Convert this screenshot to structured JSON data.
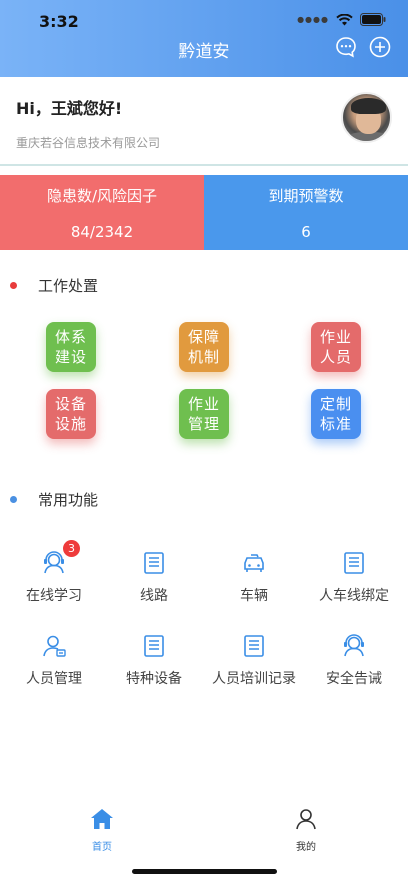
{
  "status_bar": {
    "time": "3:32"
  },
  "nav": {
    "title": "黔道安"
  },
  "profile": {
    "greeting": "Hi，王斌您好!",
    "company": "重庆若谷信息技术有限公司"
  },
  "stats": [
    {
      "label": "隐患数/风险因子",
      "value": "84/2342",
      "color": "#f26d6d"
    },
    {
      "label": "到期预警数",
      "value": "6",
      "color": "#4a98ec"
    }
  ],
  "work_section": {
    "title": "工作处置",
    "dot_color": "#e83c3c",
    "tiles": [
      {
        "line1": "体系",
        "line2": "建设",
        "color": "#6fbf4f"
      },
      {
        "line1": "保障",
        "line2": "机制",
        "color": "#e19a3e"
      },
      {
        "line1": "作业",
        "line2": "人员",
        "color": "#e46b6b"
      },
      {
        "line1": "设备",
        "line2": "设施",
        "color": "#e46b6b"
      },
      {
        "line1": "作业",
        "line2": "管理",
        "color": "#6fbf4f"
      },
      {
        "line1": "定制",
        "line2": "标准",
        "color": "#4a8ff0"
      }
    ]
  },
  "common_section": {
    "title": "常用功能",
    "dot_color": "#4a90e2",
    "items": [
      {
        "label": "在线学习",
        "icon": "person-headset-icon",
        "badge": "3"
      },
      {
        "label": "线路",
        "icon": "document-icon"
      },
      {
        "label": "车辆",
        "icon": "car-icon"
      },
      {
        "label": "人车线绑定",
        "icon": "document-icon"
      },
      {
        "label": "人员管理",
        "icon": "person-card-icon"
      },
      {
        "label": "特种设备",
        "icon": "document-icon"
      },
      {
        "label": "人员培训记录",
        "icon": "document-icon"
      },
      {
        "label": "安全告诫",
        "icon": "person-headset-icon"
      }
    ]
  },
  "tabbar": {
    "items": [
      {
        "label": "首页",
        "icon": "home-icon",
        "active": true
      },
      {
        "label": "我的",
        "icon": "user-icon",
        "active": false
      }
    ],
    "active_color": "#3a8ee6",
    "inactive_color": "#333333"
  }
}
